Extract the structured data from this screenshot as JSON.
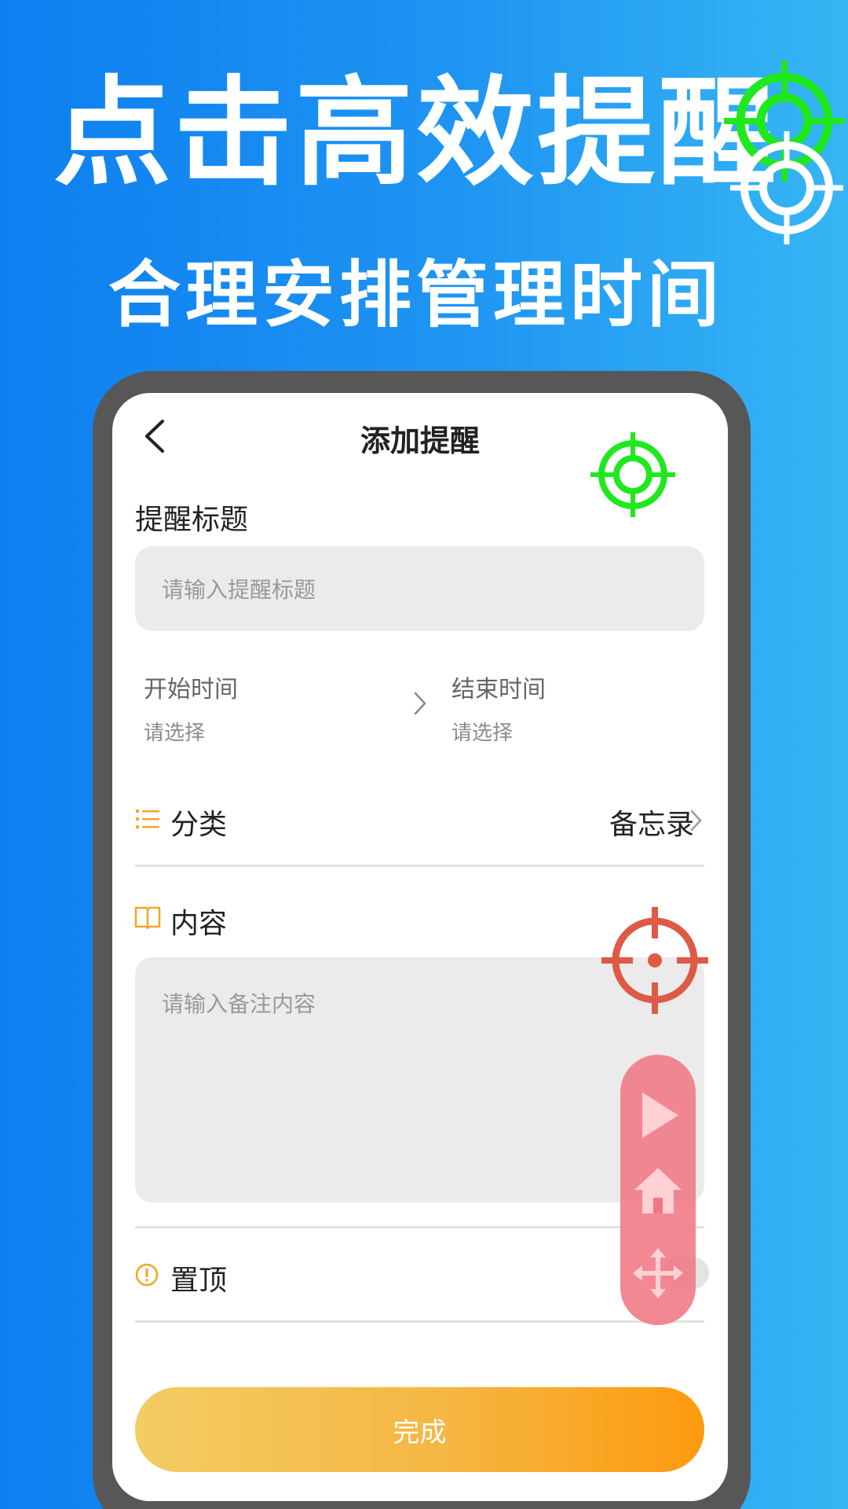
{
  "headline": "点击高效提醒",
  "subheadline": "合理安排管理时间",
  "app": {
    "nav_title": "添加提醒",
    "title_section_label": "提醒标题",
    "title_placeholder": "请输入提醒标题",
    "start_time": {
      "label": "开始时间",
      "value": "请选择"
    },
    "end_time": {
      "label": "结束时间",
      "value": "请选择"
    },
    "category": {
      "label": "分类",
      "value": "备忘录"
    },
    "content": {
      "label": "内容",
      "placeholder": "请输入备注内容"
    },
    "pin": {
      "label": "置顶"
    },
    "done_label": "完成"
  },
  "colors": {
    "background_left": "#0d7ff0",
    "background_right": "#36b6f4",
    "accent_orange": "#f5a623",
    "button_start": "#f3cc63",
    "button_end": "#fd9a0f",
    "target_green": "#1fe81f",
    "target_red": "#dd5a46",
    "float_bar": "#f07884"
  },
  "icons": [
    "back-icon",
    "forward-chevron-icon",
    "list-icon",
    "book-icon",
    "info-circle-icon",
    "chevron-right-icon",
    "crosshair-icon",
    "play-icon",
    "home-icon",
    "move-arrows-icon"
  ]
}
